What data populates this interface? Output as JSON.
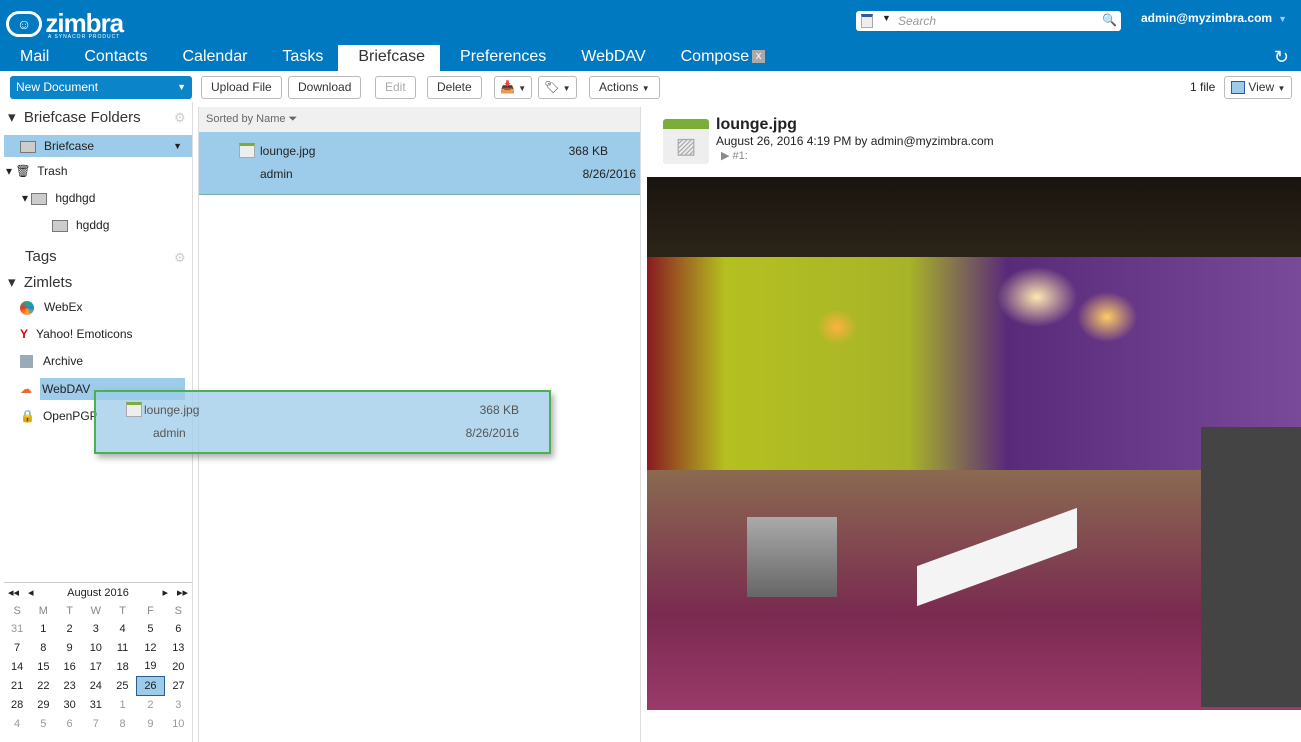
{
  "brand": {
    "name": "zimbra",
    "tagline": "A SYNACOR PRODUCT"
  },
  "search": {
    "placeholder": "Search"
  },
  "user": "admin@myzimbra.com",
  "tabs": [
    "Mail",
    "Contacts",
    "Calendar",
    "Tasks",
    "Briefcase",
    "Preferences",
    "WebDAV",
    "Compose"
  ],
  "active_tab": "Briefcase",
  "toolbar": {
    "new_document": "New Document",
    "upload": "Upload File",
    "download": "Download",
    "edit": "Edit",
    "delete": "Delete",
    "actions": "Actions",
    "count": "1 file",
    "view": "View"
  },
  "sidebar": {
    "folders_header": "Briefcase Folders",
    "folders": [
      {
        "label": "Briefcase"
      },
      {
        "label": "Trash"
      },
      {
        "label": "hgdhgd"
      },
      {
        "label": "hgddg"
      }
    ],
    "tags_header": "Tags",
    "zimlets_header": "Zimlets",
    "zimlets": [
      {
        "label": "WebEx"
      },
      {
        "label": "Yahoo! Emoticons"
      },
      {
        "label": "Archive"
      },
      {
        "label": "WebDAV"
      },
      {
        "label": "OpenPGP"
      }
    ]
  },
  "calendar": {
    "month": "August 2016",
    "dow": [
      "S",
      "M",
      "T",
      "W",
      "T",
      "F",
      "S"
    ],
    "weeks": [
      [
        "31",
        "1",
        "2",
        "3",
        "4",
        "5",
        "6"
      ],
      [
        "7",
        "8",
        "9",
        "10",
        "11",
        "12",
        "13"
      ],
      [
        "14",
        "15",
        "16",
        "17",
        "18",
        "19",
        "20"
      ],
      [
        "21",
        "22",
        "23",
        "24",
        "25",
        "26",
        "27"
      ],
      [
        "28",
        "29",
        "30",
        "31",
        "1",
        "2",
        "3"
      ],
      [
        "4",
        "5",
        "6",
        "7",
        "8",
        "9",
        "10"
      ]
    ],
    "today": "26"
  },
  "list": {
    "sort_label": "Sorted by Name",
    "file": {
      "name": "lounge.jpg",
      "size": "368 KB",
      "owner": "admin",
      "date": "8/26/2016"
    }
  },
  "preview": {
    "title": "lounge.jpg",
    "meta": "August 26, 2016 4:19 PM by admin@myzimbra.com",
    "version": "#1:"
  }
}
